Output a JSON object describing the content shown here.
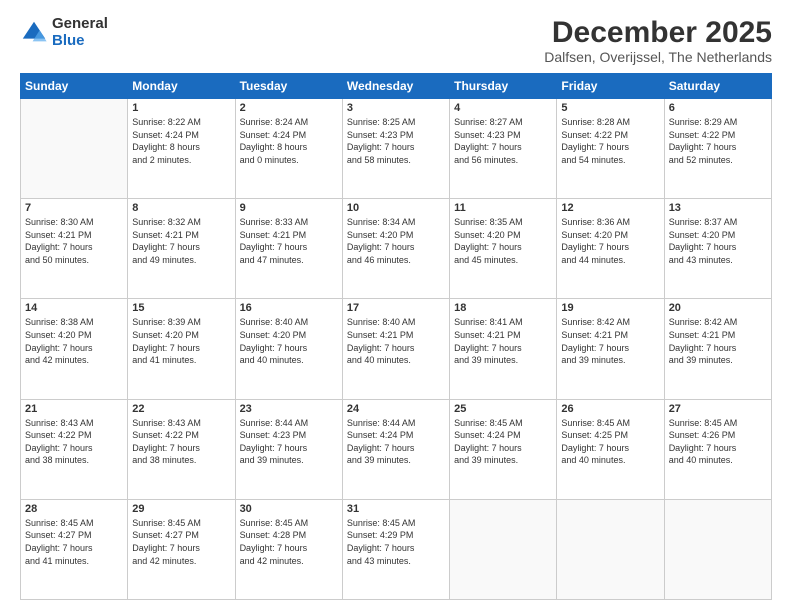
{
  "logo": {
    "general": "General",
    "blue": "Blue"
  },
  "title": "December 2025",
  "location": "Dalfsen, Overijssel, The Netherlands",
  "days_header": [
    "Sunday",
    "Monday",
    "Tuesday",
    "Wednesday",
    "Thursday",
    "Friday",
    "Saturday"
  ],
  "weeks": [
    [
      {
        "num": "",
        "info": ""
      },
      {
        "num": "1",
        "info": "Sunrise: 8:22 AM\nSunset: 4:24 PM\nDaylight: 8 hours\nand 2 minutes."
      },
      {
        "num": "2",
        "info": "Sunrise: 8:24 AM\nSunset: 4:24 PM\nDaylight: 8 hours\nand 0 minutes."
      },
      {
        "num": "3",
        "info": "Sunrise: 8:25 AM\nSunset: 4:23 PM\nDaylight: 7 hours\nand 58 minutes."
      },
      {
        "num": "4",
        "info": "Sunrise: 8:27 AM\nSunset: 4:23 PM\nDaylight: 7 hours\nand 56 minutes."
      },
      {
        "num": "5",
        "info": "Sunrise: 8:28 AM\nSunset: 4:22 PM\nDaylight: 7 hours\nand 54 minutes."
      },
      {
        "num": "6",
        "info": "Sunrise: 8:29 AM\nSunset: 4:22 PM\nDaylight: 7 hours\nand 52 minutes."
      }
    ],
    [
      {
        "num": "7",
        "info": "Sunrise: 8:30 AM\nSunset: 4:21 PM\nDaylight: 7 hours\nand 50 minutes."
      },
      {
        "num": "8",
        "info": "Sunrise: 8:32 AM\nSunset: 4:21 PM\nDaylight: 7 hours\nand 49 minutes."
      },
      {
        "num": "9",
        "info": "Sunrise: 8:33 AM\nSunset: 4:21 PM\nDaylight: 7 hours\nand 47 minutes."
      },
      {
        "num": "10",
        "info": "Sunrise: 8:34 AM\nSunset: 4:20 PM\nDaylight: 7 hours\nand 46 minutes."
      },
      {
        "num": "11",
        "info": "Sunrise: 8:35 AM\nSunset: 4:20 PM\nDaylight: 7 hours\nand 45 minutes."
      },
      {
        "num": "12",
        "info": "Sunrise: 8:36 AM\nSunset: 4:20 PM\nDaylight: 7 hours\nand 44 minutes."
      },
      {
        "num": "13",
        "info": "Sunrise: 8:37 AM\nSunset: 4:20 PM\nDaylight: 7 hours\nand 43 minutes."
      }
    ],
    [
      {
        "num": "14",
        "info": "Sunrise: 8:38 AM\nSunset: 4:20 PM\nDaylight: 7 hours\nand 42 minutes."
      },
      {
        "num": "15",
        "info": "Sunrise: 8:39 AM\nSunset: 4:20 PM\nDaylight: 7 hours\nand 41 minutes."
      },
      {
        "num": "16",
        "info": "Sunrise: 8:40 AM\nSunset: 4:20 PM\nDaylight: 7 hours\nand 40 minutes."
      },
      {
        "num": "17",
        "info": "Sunrise: 8:40 AM\nSunset: 4:21 PM\nDaylight: 7 hours\nand 40 minutes."
      },
      {
        "num": "18",
        "info": "Sunrise: 8:41 AM\nSunset: 4:21 PM\nDaylight: 7 hours\nand 39 minutes."
      },
      {
        "num": "19",
        "info": "Sunrise: 8:42 AM\nSunset: 4:21 PM\nDaylight: 7 hours\nand 39 minutes."
      },
      {
        "num": "20",
        "info": "Sunrise: 8:42 AM\nSunset: 4:21 PM\nDaylight: 7 hours\nand 39 minutes."
      }
    ],
    [
      {
        "num": "21",
        "info": "Sunrise: 8:43 AM\nSunset: 4:22 PM\nDaylight: 7 hours\nand 38 minutes."
      },
      {
        "num": "22",
        "info": "Sunrise: 8:43 AM\nSunset: 4:22 PM\nDaylight: 7 hours\nand 38 minutes."
      },
      {
        "num": "23",
        "info": "Sunrise: 8:44 AM\nSunset: 4:23 PM\nDaylight: 7 hours\nand 39 minutes."
      },
      {
        "num": "24",
        "info": "Sunrise: 8:44 AM\nSunset: 4:24 PM\nDaylight: 7 hours\nand 39 minutes."
      },
      {
        "num": "25",
        "info": "Sunrise: 8:45 AM\nSunset: 4:24 PM\nDaylight: 7 hours\nand 39 minutes."
      },
      {
        "num": "26",
        "info": "Sunrise: 8:45 AM\nSunset: 4:25 PM\nDaylight: 7 hours\nand 40 minutes."
      },
      {
        "num": "27",
        "info": "Sunrise: 8:45 AM\nSunset: 4:26 PM\nDaylight: 7 hours\nand 40 minutes."
      }
    ],
    [
      {
        "num": "28",
        "info": "Sunrise: 8:45 AM\nSunset: 4:27 PM\nDaylight: 7 hours\nand 41 minutes."
      },
      {
        "num": "29",
        "info": "Sunrise: 8:45 AM\nSunset: 4:27 PM\nDaylight: 7 hours\nand 42 minutes."
      },
      {
        "num": "30",
        "info": "Sunrise: 8:45 AM\nSunset: 4:28 PM\nDaylight: 7 hours\nand 42 minutes."
      },
      {
        "num": "31",
        "info": "Sunrise: 8:45 AM\nSunset: 4:29 PM\nDaylight: 7 hours\nand 43 minutes."
      },
      {
        "num": "",
        "info": ""
      },
      {
        "num": "",
        "info": ""
      },
      {
        "num": "",
        "info": ""
      }
    ]
  ]
}
